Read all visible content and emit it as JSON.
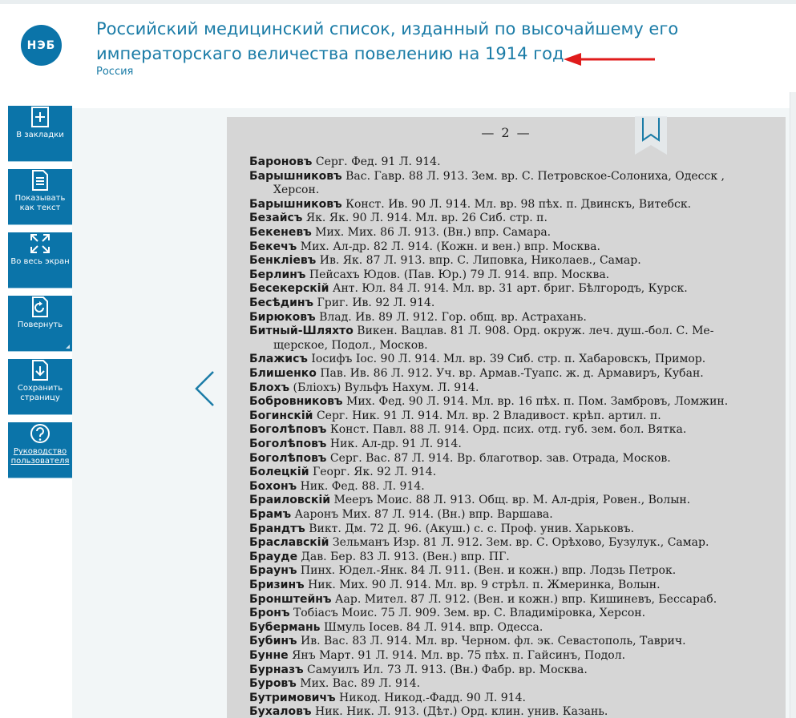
{
  "header": {
    "logo_text": "НЭБ",
    "title_line1": "Российский медицинский список, изданный по высочайшему его",
    "title_line2": "императорскаго величества повелению на 1914 год",
    "subtitle": "Россия"
  },
  "toolbar": [
    {
      "name": "bookmark",
      "label": "В закладки",
      "icon": "bookmark-plus-icon"
    },
    {
      "name": "show-text",
      "label": "Показывать как текст",
      "icon": "document-text-icon"
    },
    {
      "name": "fullscreen",
      "label": "Во весь экран",
      "icon": "fullscreen-icon"
    },
    {
      "name": "rotate",
      "label": "Повернуть",
      "icon": "rotate-icon"
    },
    {
      "name": "save-page",
      "label": "Сохранить страницу",
      "icon": "download-icon"
    },
    {
      "name": "user-guide",
      "label": "Руководство пользователя",
      "icon": "help-icon"
    }
  ],
  "page": {
    "number": "— 2 —",
    "lines": [
      {
        "name": "Бароновъ",
        "text": " Серг. Фед. 91 Л. 914."
      },
      {
        "name": "Барышниковъ",
        "text": " Вас. Гавр. 88 Л. 913. Зем. вр.  С. Петровское-Солониха,  Одесск ,"
      },
      {
        "name": "",
        "text": "Херсон."
      },
      {
        "name": "Барышниковъ",
        "text": " Конст. Ив. 90 Л. 914. Мл. вр. 98 пѣх. п. Двинскъ, Витебск."
      },
      {
        "name": "Безайсъ",
        "text": " Як. Як. 90 Л. 914. Мл. вр. 26 Сиб. стр. п."
      },
      {
        "name": "Бекеневъ",
        "text": " Мих. Мих. 86 Л. 913. (Вн.) впр. Самара."
      },
      {
        "name": "Бекечъ",
        "text": " Мих. Ал-др. 82 Л. 914. (Кожн. и вен.) впр. Москва."
      },
      {
        "name": "Бенклiевъ",
        "text": " Ив. Як. 87 Л. 913. впр. С. Липовка, Николаев., Самар."
      },
      {
        "name": "Берлинъ",
        "text": " Пейсахъ Юдов. (Пав. Юр.) 79 Л. 914. впр. Москва."
      },
      {
        "name": "Бесекерскiй",
        "text": " Ант. Юл. 84 Л. 914. Мл. вр. 31 арт. бриг. Бѣлгородъ, Курск."
      },
      {
        "name": "Бесѣдинъ",
        "text": " Григ. Ив. 92 Л. 914."
      },
      {
        "name": "Бирюковъ",
        "text": " Влад. Ив. 89 Л. 912. Гор. общ. вр. Астрахань."
      },
      {
        "name": "Битный-Шляхто",
        "text": " Викен. Вацлав. 81 Л. 908. Орд. окруж. леч. душ.-бол. С. Ме-"
      },
      {
        "name": "",
        "text": "щерское, Подол., Москов."
      },
      {
        "name": "Блажисъ",
        "text": " Iосифъ Iос. 90 Л. 914. Мл. вр. 39 Сиб. стр. п. Хабаровскъ, Примор."
      },
      {
        "name": "Блишенко",
        "text": " Пав. Ив. 86 Л. 912. Уч. вр. Армав.-Туапс. ж. д. Армавиръ, Кубан."
      },
      {
        "name": "Блохъ",
        "text": " (Блiохъ) Вульфъ Нахум. Л. 914."
      },
      {
        "name": "Бобровниковъ",
        "text": " Мих. Фед. 90 Л. 914. Мл. вр. 16 пѣх. п. Пом. Замбровъ, Ломжин."
      },
      {
        "name": "Богинскiй",
        "text": " Серг. Ник. 91 Л. 914. Мл. вр. 2 Владивост. крѣп. артил. п."
      },
      {
        "name": "Боголѣповъ",
        "text": " Конст. Павл. 88 Л. 914. Орд. псих. отд. губ. зем. бол. Вятка."
      },
      {
        "name": "Боголѣповъ",
        "text": " Ник. Ал-др. 91 Л. 914."
      },
      {
        "name": "Боголѣповъ",
        "text": " Серг. Вас. 87 Л. 914. Вр. благотвор. зав. Отрада, Москов."
      },
      {
        "name": "Болецкiй",
        "text": " Георг. Як. 92 Л. 914."
      },
      {
        "name": "Бохонъ",
        "text": " Ник. Фед. 88. Л. 914."
      },
      {
        "name": "Браиловскiй",
        "text": " Мееръ Моис. 88 Л. 913. Общ. вр. М. Ал-дрiя, Ровен., Волын."
      },
      {
        "name": "Брамъ",
        "text": " Ааронъ Мих. 87 Л. 914. (Вн.) впр. Варшава."
      },
      {
        "name": "Брандтъ",
        "text": " Викт. Дм. 72 Д. 96. (Акуш.) с. с. Проф. унив. Харьковъ."
      },
      {
        "name": "Браславскiй",
        "text": " Зельманъ Изр. 81 Л. 912. Зем. вр. С. Орѣхово, Бузулук.,  Самар."
      },
      {
        "name": "Брауде",
        "text": " Дав. Бер. 83 Л. 913. (Вен.) впр. ПГ."
      },
      {
        "name": "Браунъ",
        "text": " Пинх. Юдел.-Янк. 84 Л. 911. (Вен. и кожн.) впр. Лодзь  Петрок."
      },
      {
        "name": "Бризинъ",
        "text": " Ник. Мих. 90 Л. 914. Мл. вр. 9 стрѣл. п. Жмеринка, Волын."
      },
      {
        "name": "Бронштейнъ",
        "text": " Аар. Мител. 87 Л. 912. (Вен. и кожн.)  впр. Кишиневъ, Бессараб."
      },
      {
        "name": "Бронъ",
        "text": " Тобiасъ Моис. 75 Л. 909. Зем. вр. С. Владимiровка, Херсон."
      },
      {
        "name": "Бубермань",
        "text": " Шмуль Iосев. 84 Л. 914. впр. Одесса."
      },
      {
        "name": "Бубинъ",
        "text": " Ив. Вас. 83 Л. 914. Мл. вр. Черном. фл. эк. Севастополь, Таврич."
      },
      {
        "name": "Бунне",
        "text": " Янъ Март. 91 Л. 914. Мл. вр. 75 пѣх. п. Гайсинъ, Подол."
      },
      {
        "name": "Бурназъ",
        "text": " Самуилъ Ил. 73 Л. 913. (Вн.) Фабр. вр. Москва."
      },
      {
        "name": "Буровъ",
        "text": " Мих. Вас. 89 Л. 914."
      },
      {
        "name": "Бутримовичъ",
        "text": " Никод. Никод.-Фадд. 90 Л. 914."
      },
      {
        "name": "Бухаловъ",
        "text": " Ник. Ник.  Л. 913. (Дѣт.) Орд. клин. унив. Казань."
      }
    ]
  },
  "colors": {
    "brand": "#0b74a9",
    "title": "#1b7ca7",
    "arrow": "#e01b1b",
    "page_bg": "#d6d6d6"
  }
}
